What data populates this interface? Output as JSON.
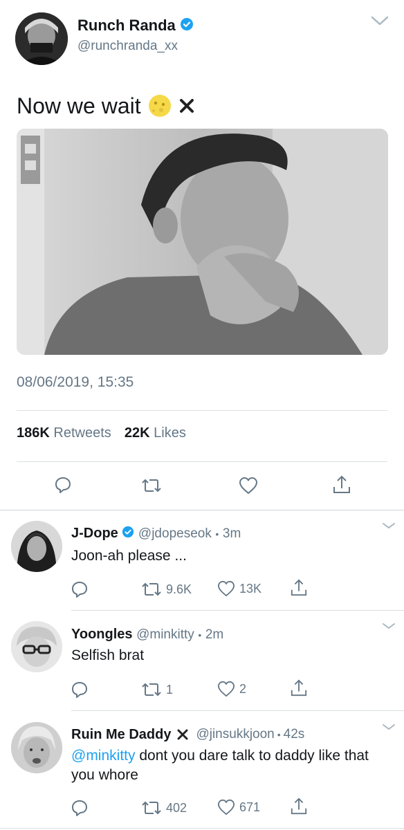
{
  "main_tweet": {
    "display_name": "Runch Randa",
    "handle": "@runchranda_xx",
    "text": "Now we wait",
    "timestamp": "08/06/2019, 15:35",
    "retweets_count": "186K",
    "retweets_label": "Retweets",
    "likes_count": "22K",
    "likes_label": "Likes"
  },
  "replies": [
    {
      "display_name": "J-Dope",
      "handle": "@jdopeseok",
      "time": "3m",
      "text": "Joon-ah please ...",
      "retweets": "9.6K",
      "likes": "13K"
    },
    {
      "display_name": "Yoongles",
      "handle": "@minkitty",
      "time": "2m",
      "text": "Selfish brat",
      "retweets": "1",
      "likes": "2"
    },
    {
      "display_name": "Ruin Me Daddy",
      "handle": "@jinsukkjoon",
      "time": "42s",
      "mention": "@minkitty",
      "text": " dont you dare talk to daddy like that you whore",
      "retweets": "402",
      "likes": "671"
    }
  ],
  "separator": "•",
  "colors": {
    "accent": "#1da1f2",
    "muted": "#657786",
    "divider": "#dadfe3"
  }
}
